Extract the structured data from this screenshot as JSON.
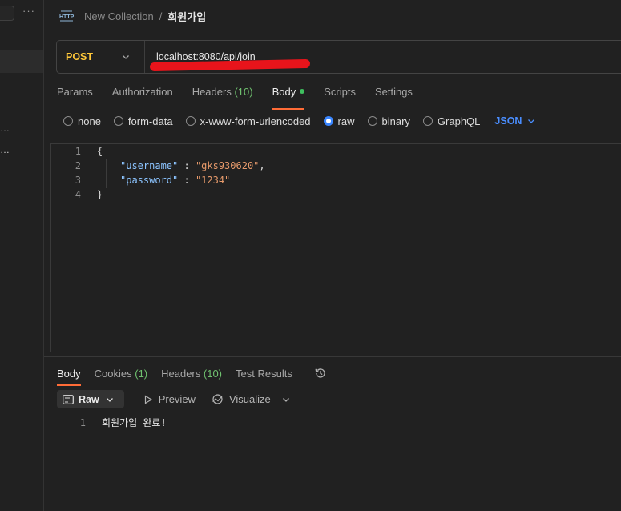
{
  "sidebar": {
    "more": "···",
    "truncated_items": [
      "…",
      "…"
    ]
  },
  "header": {
    "collection": "New Collection",
    "separator": "/",
    "request_name": "회원가입"
  },
  "request": {
    "method": "POST",
    "url": "localhost:8080/api/join"
  },
  "request_tabs": [
    {
      "label": "Params"
    },
    {
      "label": "Authorization"
    },
    {
      "label": "Headers",
      "count": "(10)"
    },
    {
      "label": "Body",
      "active": true
    },
    {
      "label": "Scripts"
    },
    {
      "label": "Settings"
    }
  ],
  "body_types": [
    {
      "label": "none",
      "checked": false
    },
    {
      "label": "form-data",
      "checked": false
    },
    {
      "label": "x-www-form-urlencoded",
      "checked": false
    },
    {
      "label": "raw",
      "checked": true
    },
    {
      "label": "binary",
      "checked": false
    },
    {
      "label": "GraphQL",
      "checked": false
    }
  ],
  "body_format": "JSON",
  "editor": {
    "lines": [
      {
        "n": "1",
        "open": "{"
      },
      {
        "n": "2",
        "key": "\"username\"",
        "sep": " : ",
        "value": "\"gks930620\"",
        "tail": ","
      },
      {
        "n": "3",
        "key": "\"password\"",
        "sep": " : ",
        "value": "\"1234\"",
        "tail": ""
      },
      {
        "n": "4",
        "close": "}"
      }
    ]
  },
  "response_tabs": [
    {
      "label": "Body",
      "active": true
    },
    {
      "label": "Cookies",
      "count": "(1)"
    },
    {
      "label": "Headers",
      "count": "(10)"
    },
    {
      "label": "Test Results"
    }
  ],
  "response_toolbar": {
    "view_mode": "Raw",
    "preview": "Preview",
    "visualize": "Visualize"
  },
  "response_body": [
    {
      "n": "1",
      "text": "회원가입 완료!"
    }
  ],
  "colors": {
    "method": "#ffc83a",
    "accent_tab": "#ff6c37",
    "radio_checked": "#3a86ff",
    "json_key": "#8cc4ff",
    "json_string": "#e79a6b",
    "count_green": "#6fc16f",
    "annotation_red": "#e8141b"
  }
}
